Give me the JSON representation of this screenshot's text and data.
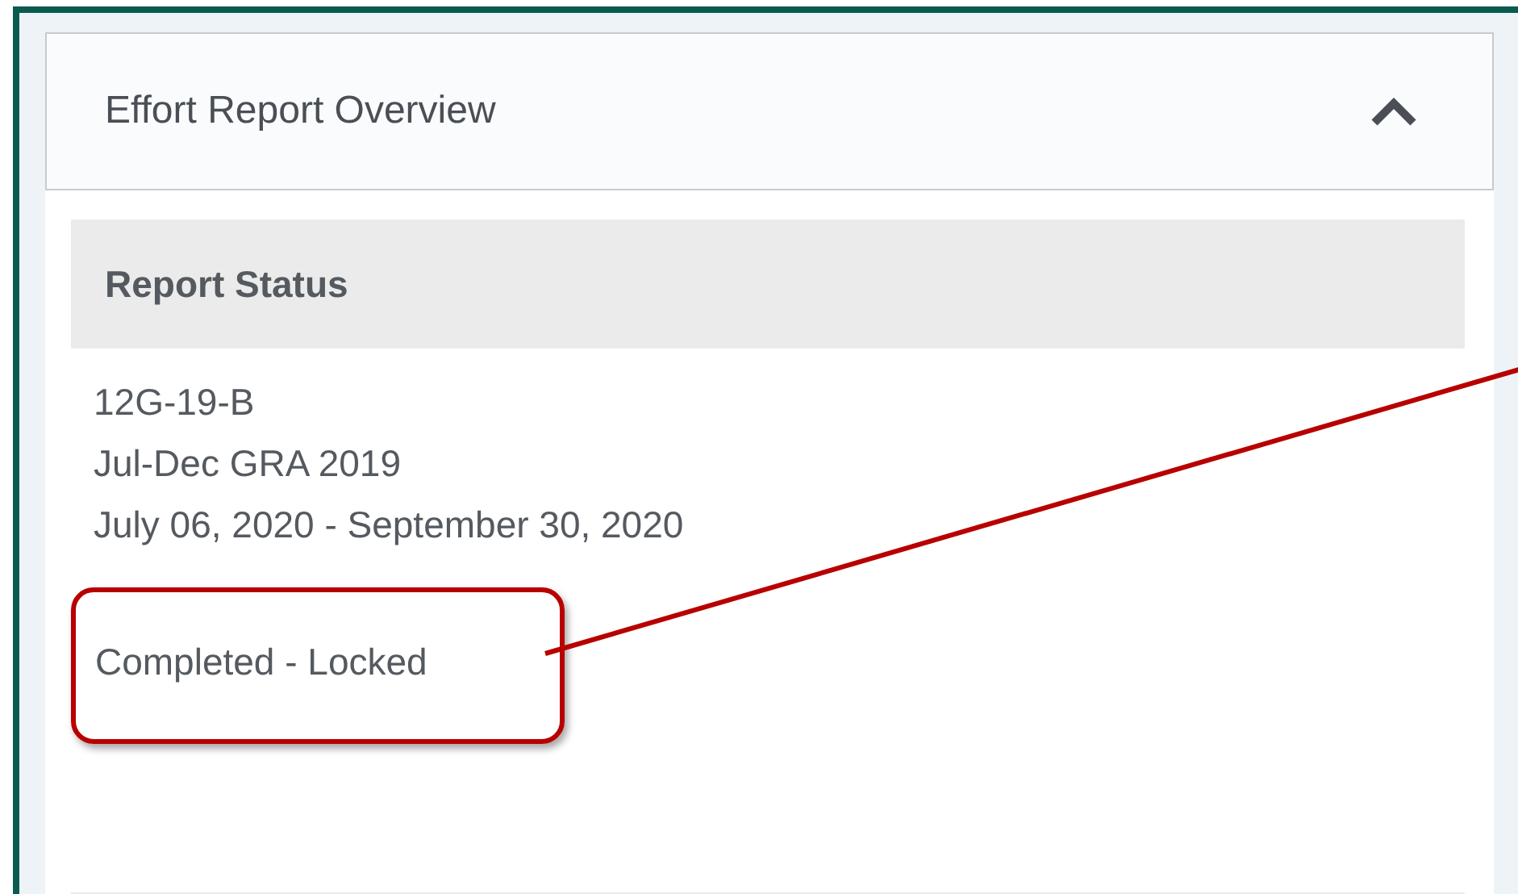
{
  "panel": {
    "title": "Effort Report Overview",
    "expanded": true
  },
  "section": {
    "heading": "Report Status",
    "lines": [
      "12G-19-B",
      "Jul-Dec GRA 2019",
      "July 06, 2020 - September 30, 2020"
    ],
    "status": {
      "text": "Completed - Locked",
      "highlighted": true
    }
  }
}
